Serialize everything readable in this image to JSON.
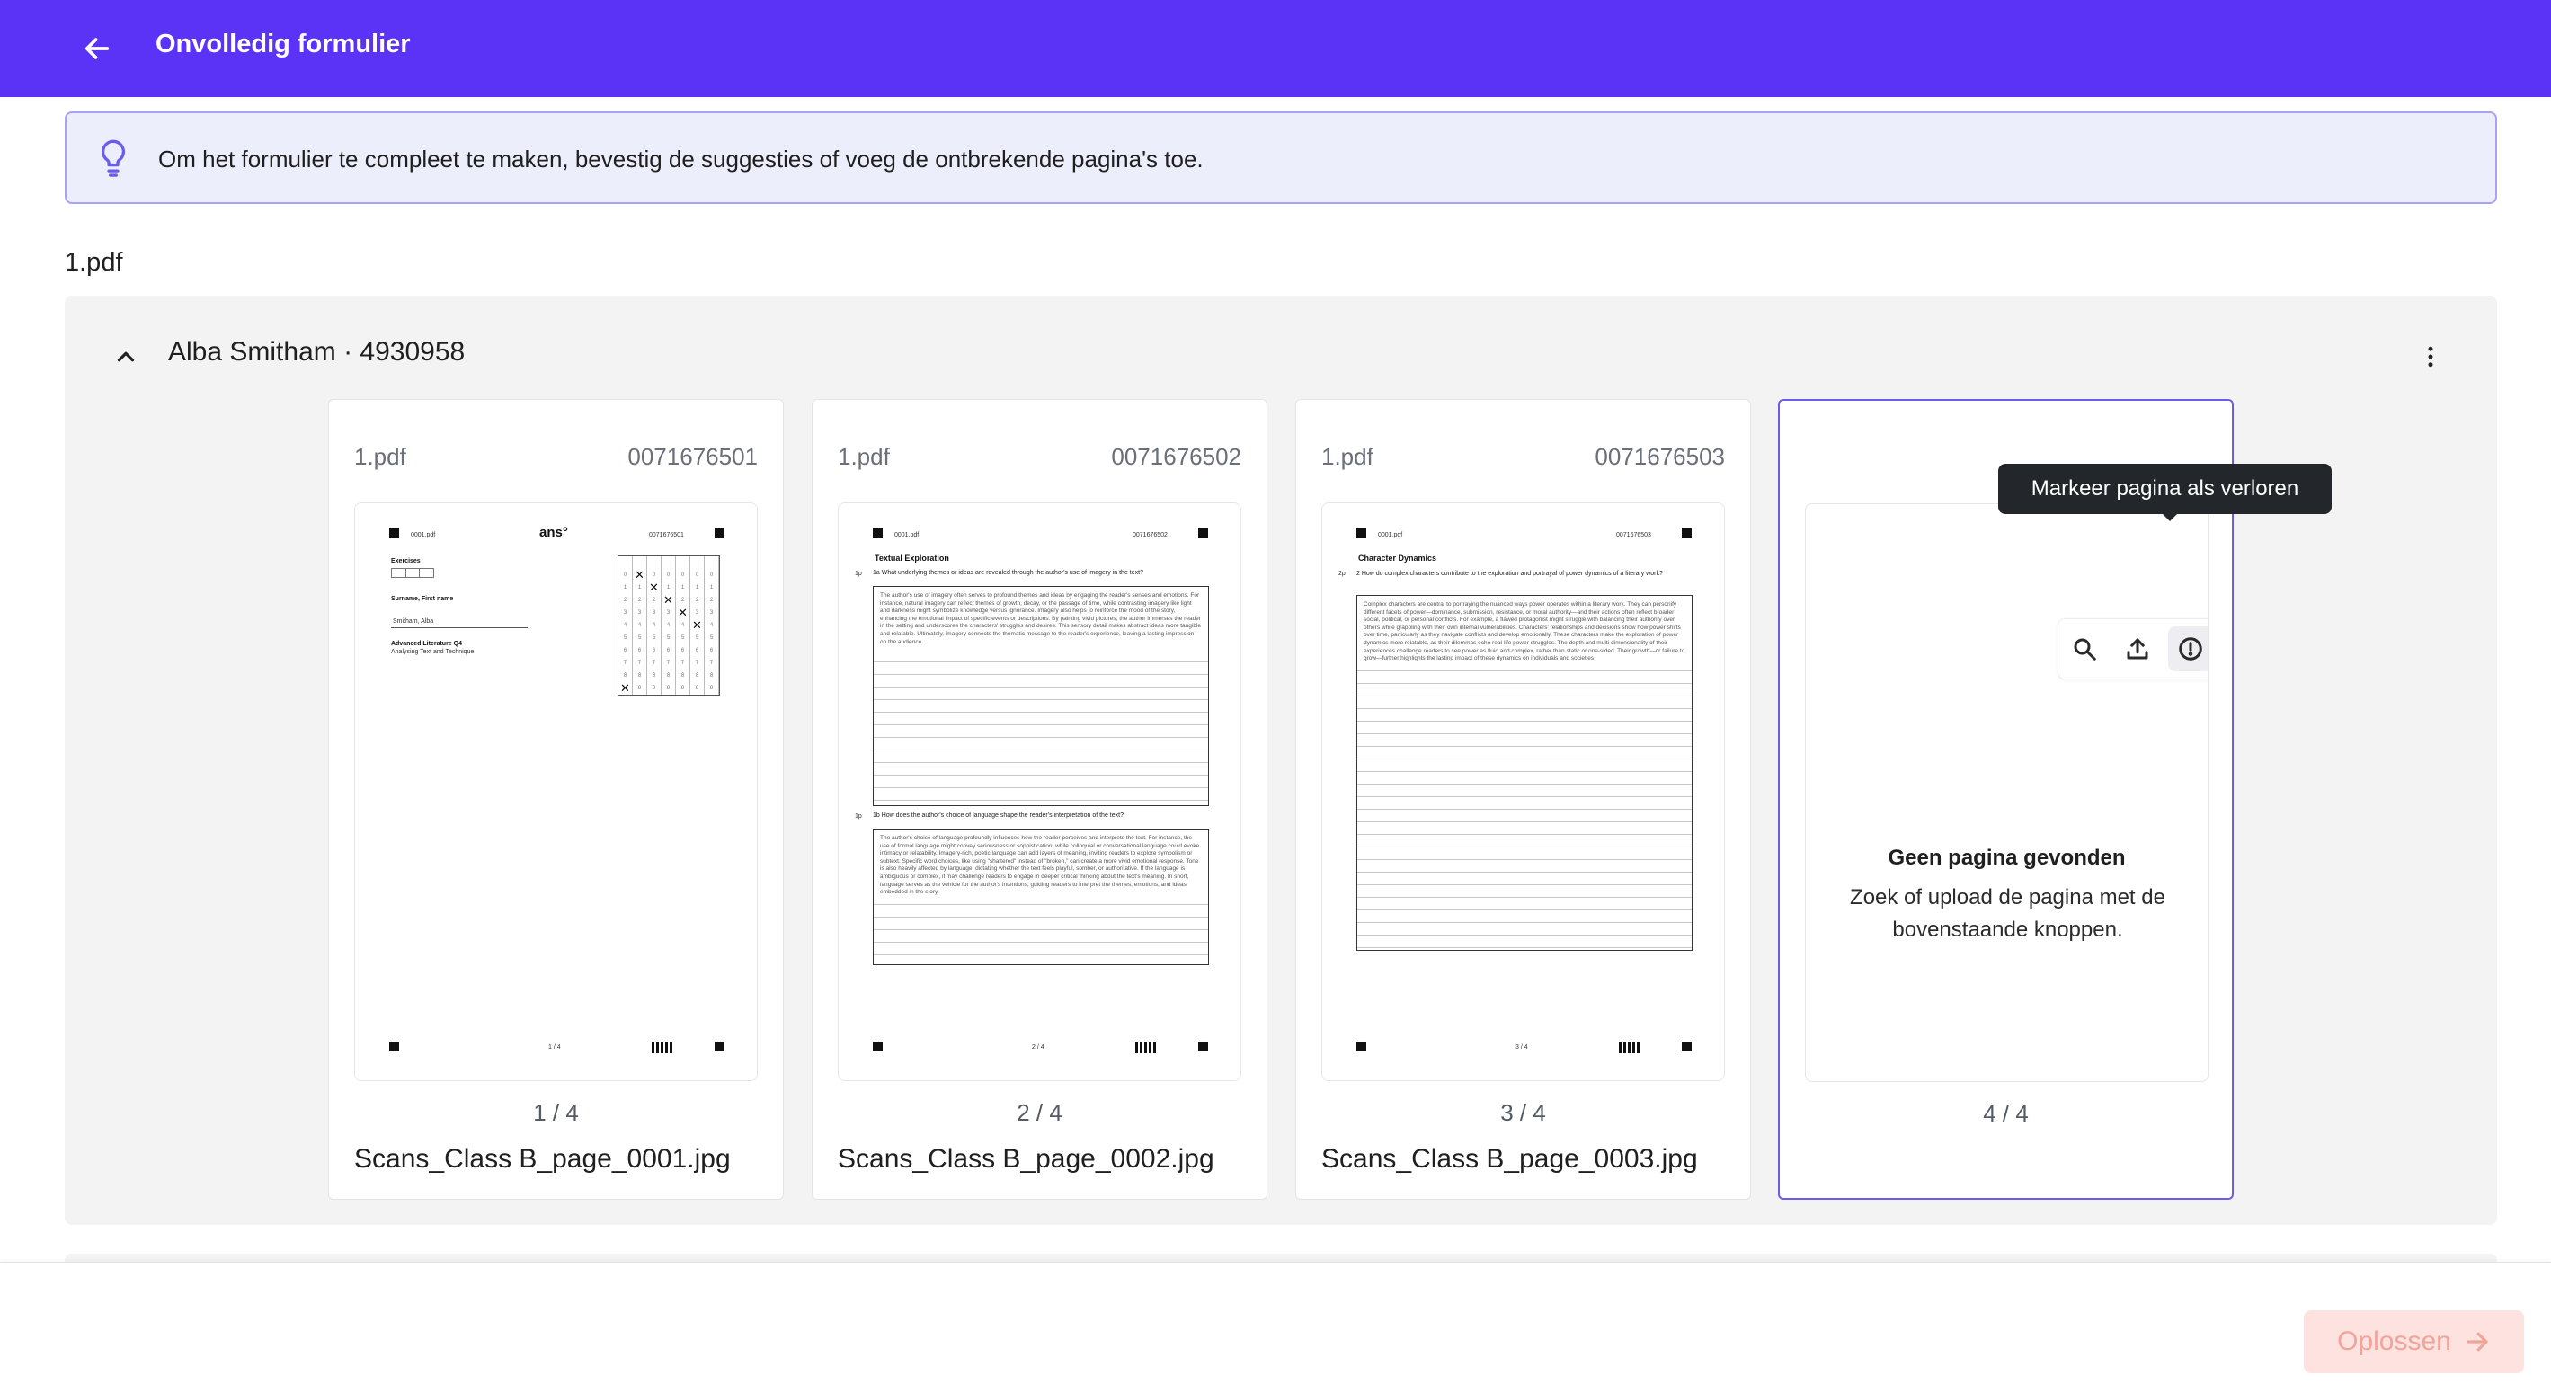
{
  "header": {
    "title": "Onvolledig formulier"
  },
  "banner": {
    "text": "Om het formulier te compleet te maken, bevestig de suggesties of voeg de ontbrekende pagina's toe."
  },
  "file": {
    "name": "1.pdf"
  },
  "student": {
    "label": "Alba Smitham · 4930958"
  },
  "cards": [
    {
      "file": "1.pdf",
      "code": "0071676501",
      "page": "1 / 4",
      "filename": "Scans_Class B_page_0001.jpg",
      "scan": {
        "header_left": "0001.pdf",
        "logo": "ans°",
        "header_right": "0071676501",
        "exercises_label": "Exercises",
        "surname_label": "Surname, First name",
        "name_value": "Smitham, Alba",
        "course": "Advanced Literature Q4",
        "course_sub": "Analysing Text and Technique",
        "footer": "1 / 4"
      }
    },
    {
      "file": "1.pdf",
      "code": "0071676502",
      "page": "2 / 4",
      "filename": "Scans_Class B_page_0002.jpg",
      "scan": {
        "header_left": "0001.pdf",
        "header_right": "0071676502",
        "title": "Textual Exploration",
        "q1_points": "1p",
        "q1": "1a   What underlying themes or ideas are revealed through the author's use of imagery in the text?",
        "a1": "The author's use of imagery often serves to profound themes and ideas by engaging the reader's senses and emotions. For instance, natural imagery can reflect themes of growth, decay, or the passage of time, while contrasting imagery like light and darkness might symbolize knowledge versus ignorance. Imagery also helps to reinforce the mood of the story, enhancing the emotional impact of specific events or descriptions. By painting vivid pictures, the author immerses the reader in the setting and underscores the characters' struggles and desires. This sensory detail makes abstract ideas more tangible and relatable. Ultimately, imagery connects the thematic message to the reader's experience, leaving a lasting impression on the audience.",
        "q2_points": "1p",
        "q2": "1b   How does the author's choice of language shape the reader's interpretation of the text?",
        "a2": "The author's choice of language profoundly influences how the reader perceives and interprets the text. For instance, the use of formal language might convey seriousness or sophistication, while colloquial or conversational language could evoke intimacy or relatability. Imagery-rich, poetic language can add layers of meaning, inviting readers to explore symbolism or subtext. Specific word choices, like using \"shattered\" instead of \"broken,\" can create a more vivid emotional response. Tone is also heavily affected by language, dictating whether the text feels playful, somber, or authoritative. If the language is ambiguous or complex, it may challenge readers to engage in deeper critical thinking about the text's meaning. In short, language serves as the vehicle for the author's intentions, guiding readers to interpret the themes, emotions, and ideas embedded in the story.",
        "footer": "2 / 4"
      }
    },
    {
      "file": "1.pdf",
      "code": "0071676503",
      "page": "3 / 4",
      "filename": "Scans_Class B_page_0003.jpg",
      "scan": {
        "header_left": "0001.pdf",
        "header_right": "0071676503",
        "title": "Character Dynamics",
        "q1_points": "2p",
        "q1": "2    How do complex characters contribute to the exploration and portrayal of power dynamics of a literary work?",
        "a1": "Complex characters are central to portraying the nuanced ways power operates within a literary work. They can personify different facets of power—dominance, submission, resistance, or moral authority—and their actions often reflect broader social, political, or personal conflicts. For example, a flawed protagonist might struggle with balancing their authority over others while grappling with their own internal vulnerabilities. Characters' relationships and decisions show how power shifts over time, particularly as they navigate conflicts and develop emotionally. These characters make the exploration of power dynamics more relatable, as their dilemmas echo real-life power struggles. The depth and multi-dimensionality of their experiences challenge readers to see power as fluid and complex, rather than static or one-sided. Their growth—or failure to grow—further highlights the lasting impact of these dynamics on individuals and societies.",
        "footer": "3 / 4"
      }
    },
    {
      "page": "4 / 4",
      "empty_title": "Geen pagina gevonden",
      "empty_desc": "Zoek of upload de pagina met de bovenstaande knoppen."
    }
  ],
  "tooltip": {
    "text": "Markeer pagina als verloren"
  },
  "footer": {
    "resolve_label": "Oplossen"
  },
  "icons": {
    "back": "arrow-left-icon",
    "bulb": "lightbulb-icon",
    "collapse": "chevron-up-icon",
    "menu": "more-vertical-icon",
    "search": "search-icon",
    "upload": "upload-icon",
    "lost": "alert-circle-icon",
    "resolve": "arrow-right-icon"
  },
  "colors": {
    "brand": "#5b33f6",
    "banner_bg": "#eceefb",
    "selected_border": "#6b5cf0",
    "resolve_bg": "#fde2df",
    "resolve_text": "#f0a49a"
  }
}
